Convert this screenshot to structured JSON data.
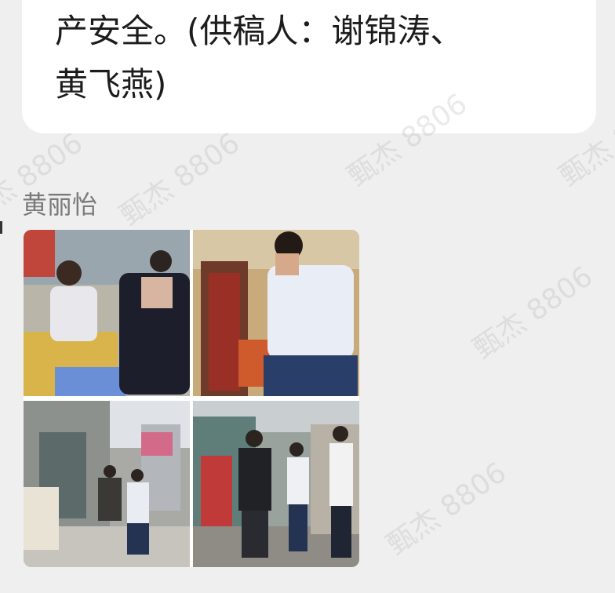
{
  "message": {
    "line1": "产安全。(供稿人：谢锦涛、",
    "line2": "黄飞燕)"
  },
  "sender": {
    "name": "黄丽怡"
  },
  "photos": [
    {
      "name": "photo-1"
    },
    {
      "name": "photo-2"
    },
    {
      "name": "photo-3"
    },
    {
      "name": "photo-4"
    }
  ],
  "watermark": {
    "text": "甄杰 8806"
  }
}
